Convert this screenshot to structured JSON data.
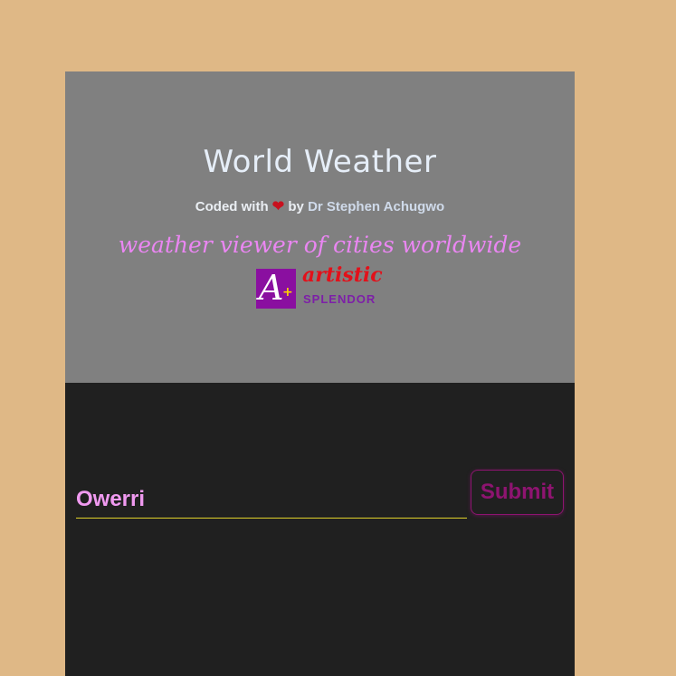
{
  "header": {
    "title": "World Weather",
    "credit_prefix": "Coded with",
    "credit_by": "by",
    "credit_author": "Dr Stephen Achugwo",
    "tagline": "weather viewer of cities worldwide"
  },
  "logo": {
    "mark_letter": "A",
    "mark_plus": "+",
    "word": "artistic",
    "sub": "SPLENDOR"
  },
  "form": {
    "city_value": "Owerri",
    "submit_label": "Submit"
  },
  "colors": {
    "page_background": "#dfb886",
    "header_background": "#808080",
    "panel_background": "#202020",
    "accent_pink": "#ea86f2",
    "button_magenta": "#8e1470",
    "input_underline": "#e0d12a",
    "heart_red": "#c8101e"
  },
  "icons": {
    "heart": "heart-icon"
  }
}
